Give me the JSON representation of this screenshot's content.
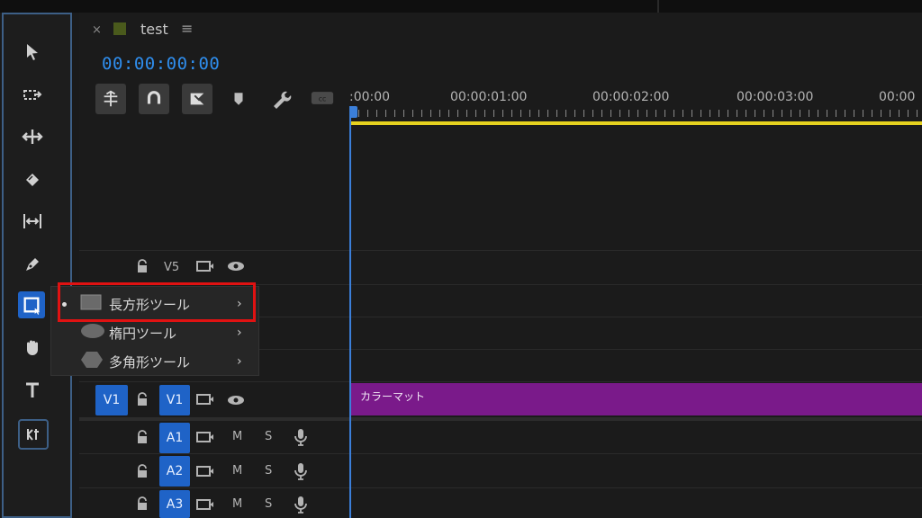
{
  "sequence": {
    "close": "×",
    "name": "test",
    "menu": "≡"
  },
  "timecode": "00:00:00:00",
  "ruler": {
    "labels": [
      ":00:00",
      "00:00:01:00",
      "00:00:02:00",
      "00:00:03:00",
      "00:00"
    ]
  },
  "tracks": {
    "v5": {
      "label": "V5"
    },
    "v1": {
      "source": "V1",
      "target": "V1"
    },
    "audio": [
      {
        "label": "A1",
        "m": "M",
        "s": "S"
      },
      {
        "label": "A2",
        "m": "M",
        "s": "S"
      },
      {
        "label": "A3",
        "m": "M",
        "s": "S"
      }
    ]
  },
  "clip": {
    "label": "カラーマット",
    "color": "#7a1a8a"
  },
  "flyout": {
    "items": [
      {
        "label": "長方形ツール",
        "selected": true
      },
      {
        "label": "楕円ツール"
      },
      {
        "label": "多角形ツール"
      }
    ]
  },
  "colors": {
    "accent": "#2f8eee",
    "highlight": "#e01212",
    "timeline_bar": "#e6d21f"
  },
  "icons": [
    "selection-tool-icon",
    "track-select-icon",
    "ripple-edit-icon",
    "razor-icon",
    "slip-icon",
    "pen-icon",
    "rectangle-tool-icon",
    "hand-icon",
    "type-icon",
    "captions-icon"
  ]
}
